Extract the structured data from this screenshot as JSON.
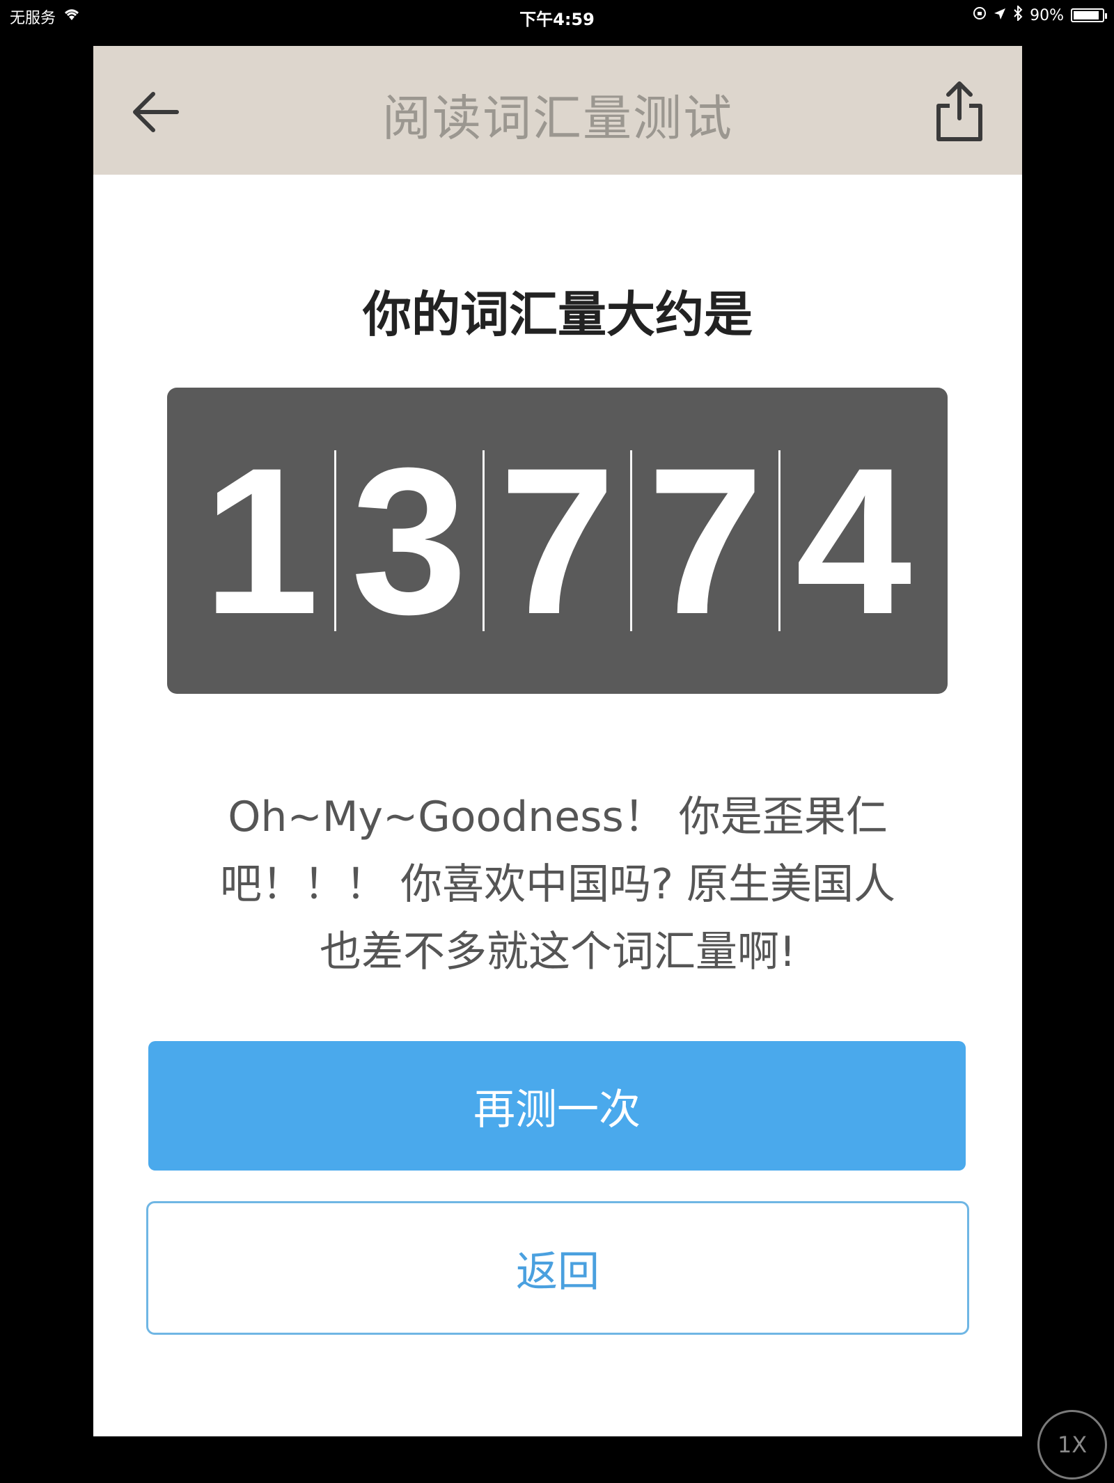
{
  "status_bar": {
    "carrier": "无服务",
    "time": "下午4:59",
    "battery": "90%",
    "battery_level": 0.9
  },
  "navbar": {
    "title": "阅读词汇量测试",
    "back_icon": "arrow-left-icon",
    "share_icon": "share-icon"
  },
  "result": {
    "heading": "你的词汇量大约是",
    "digits": [
      "1",
      "3",
      "7",
      "7",
      "4"
    ],
    "message_lines": [
      "Oh~My~Goodness！ 你是歪果仁",
      "吧！！！ 你喜欢中国吗? 原生美国人",
      "也差不多就这个词汇量啊!"
    ]
  },
  "actions": {
    "retry_label": "再测一次",
    "back_label": "返回"
  },
  "overlay": {
    "speed_label": "1X"
  },
  "colors": {
    "navbar_bg": "#ddd6cd",
    "counter_bg": "#5a5a5a",
    "primary_button": "#4aa9ec",
    "secondary_border": "#6fb6e4"
  }
}
